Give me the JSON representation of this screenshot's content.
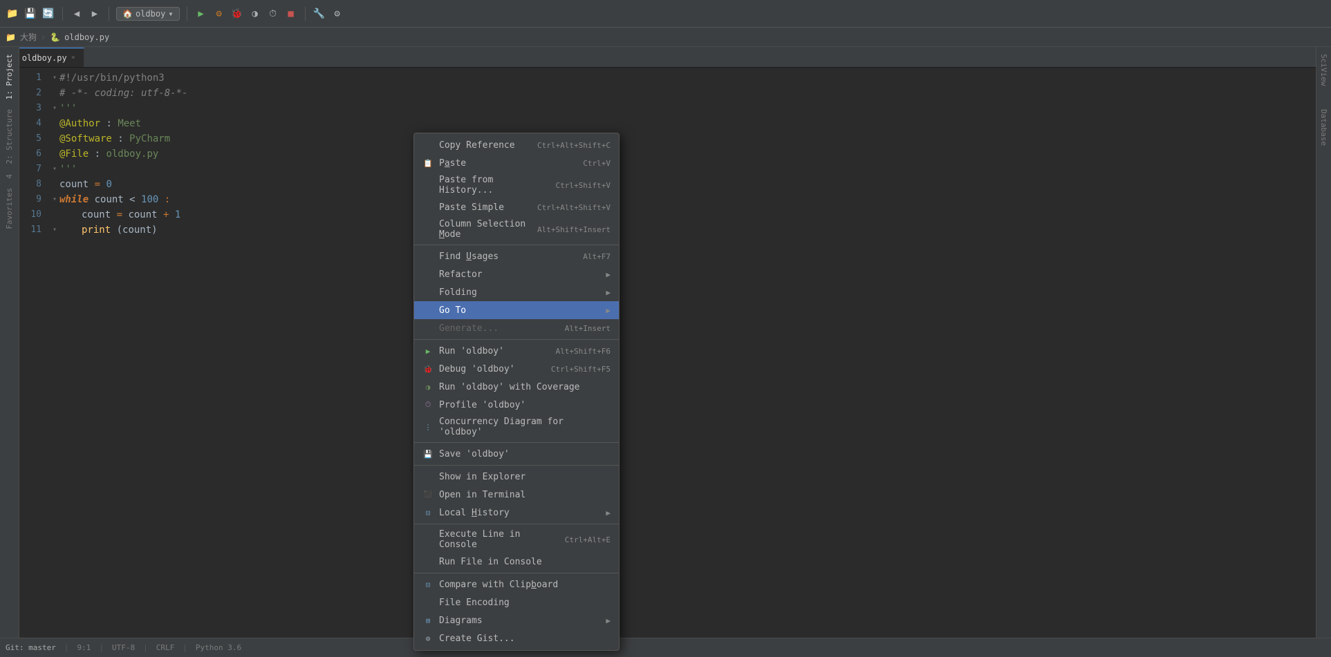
{
  "toolbar": {
    "project_name": "oldboy",
    "dropdown_arrow": "▾"
  },
  "breadcrumb": {
    "items": [
      "大狗",
      "oldboy.py"
    ]
  },
  "tab": {
    "label": "oldboy.py",
    "close": "×"
  },
  "editor": {
    "lines": [
      {
        "num": "1",
        "fold": "▾",
        "html": "shebang"
      },
      {
        "num": "2",
        "fold": "",
        "html": "coding"
      },
      {
        "num": "3",
        "fold": "▾",
        "html": "triple1"
      },
      {
        "num": "4",
        "fold": "",
        "html": "author"
      },
      {
        "num": "5",
        "fold": "",
        "html": "software"
      },
      {
        "num": "6",
        "fold": "",
        "html": "file"
      },
      {
        "num": "7",
        "fold": "▾",
        "html": "triple2"
      },
      {
        "num": "8",
        "fold": "",
        "html": "count_assign"
      },
      {
        "num": "9",
        "fold": "▾",
        "html": "while_line"
      },
      {
        "num": "10",
        "fold": "",
        "html": "count_increment"
      },
      {
        "num": "11",
        "fold": "▾",
        "html": "print_line"
      }
    ]
  },
  "context_menu": {
    "items": [
      {
        "id": "copy-reference",
        "label": "Copy Reference",
        "shortcut": "Ctrl+Alt+Shift+C",
        "icon": "",
        "arrow": false,
        "separator_after": false,
        "disabled": false
      },
      {
        "id": "paste",
        "label": "Paste",
        "shortcut": "Ctrl+V",
        "icon": "📋",
        "arrow": false,
        "separator_after": false,
        "disabled": false
      },
      {
        "id": "paste-history",
        "label": "Paste from History...",
        "shortcut": "Ctrl+Shift+V",
        "icon": "",
        "arrow": false,
        "separator_after": false,
        "disabled": false
      },
      {
        "id": "paste-simple",
        "label": "Paste Simple",
        "shortcut": "Ctrl+Alt+Shift+V",
        "icon": "",
        "arrow": false,
        "separator_after": false,
        "disabled": false
      },
      {
        "id": "column-mode",
        "label": "Column Selection Mode",
        "shortcut": "Alt+Shift+Insert",
        "icon": "",
        "arrow": false,
        "separator_after": true,
        "disabled": false
      },
      {
        "id": "find-usages",
        "label": "Find Usages",
        "shortcut": "Alt+F7",
        "icon": "",
        "arrow": false,
        "separator_after": false,
        "disabled": false
      },
      {
        "id": "refactor",
        "label": "Refactor",
        "shortcut": "",
        "icon": "",
        "arrow": true,
        "separator_after": false,
        "disabled": false
      },
      {
        "id": "folding",
        "label": "Folding",
        "shortcut": "",
        "icon": "",
        "arrow": true,
        "separator_after": false,
        "disabled": false
      },
      {
        "id": "go-to",
        "label": "Go To",
        "shortcut": "",
        "icon": "",
        "arrow": true,
        "separator_after": false,
        "disabled": false,
        "active": true
      },
      {
        "id": "generate",
        "label": "Generate...",
        "shortcut": "Alt+Insert",
        "icon": "",
        "arrow": false,
        "separator_after": true,
        "disabled": true
      },
      {
        "id": "run-oldboy",
        "label": "Run 'oldboy'",
        "shortcut": "Alt+Shift+F6",
        "icon": "▶",
        "arrow": false,
        "separator_after": false,
        "disabled": false
      },
      {
        "id": "debug-oldboy",
        "label": "Debug 'oldboy'",
        "shortcut": "Ctrl+Shift+F5",
        "icon": "🐞",
        "arrow": false,
        "separator_after": false,
        "disabled": false
      },
      {
        "id": "run-coverage",
        "label": "Run 'oldboy' with Coverage",
        "shortcut": "",
        "icon": "◑",
        "arrow": false,
        "separator_after": false,
        "disabled": false
      },
      {
        "id": "profile-oldboy",
        "label": "Profile 'oldboy'",
        "shortcut": "",
        "icon": "⏱",
        "arrow": false,
        "separator_after": false,
        "disabled": false
      },
      {
        "id": "concurrency",
        "label": "Concurrency Diagram for 'oldboy'",
        "shortcut": "",
        "icon": "⋮",
        "arrow": false,
        "separator_after": true,
        "disabled": false
      },
      {
        "id": "save-oldboy",
        "label": "Save 'oldboy'",
        "shortcut": "",
        "icon": "💾",
        "arrow": false,
        "separator_after": true,
        "disabled": false
      },
      {
        "id": "show-explorer",
        "label": "Show in Explorer",
        "shortcut": "",
        "icon": "",
        "arrow": false,
        "separator_after": false,
        "disabled": false
      },
      {
        "id": "open-terminal",
        "label": "Open in Terminal",
        "shortcut": "",
        "icon": "⬛",
        "arrow": false,
        "separator_after": false,
        "disabled": false
      },
      {
        "id": "local-history",
        "label": "Local History",
        "shortcut": "",
        "icon": "",
        "arrow": true,
        "separator_after": true,
        "disabled": false
      },
      {
        "id": "exec-line",
        "label": "Execute Line in Console",
        "shortcut": "Ctrl+Alt+E",
        "icon": "",
        "arrow": false,
        "separator_after": false,
        "disabled": false
      },
      {
        "id": "run-file-console",
        "label": "Run File in Console",
        "shortcut": "",
        "icon": "",
        "arrow": false,
        "separator_after": true,
        "disabled": false
      },
      {
        "id": "compare-clipboard",
        "label": "Compare with Clipboard",
        "shortcut": "",
        "icon": "⊡",
        "arrow": false,
        "separator_after": false,
        "disabled": false
      },
      {
        "id": "file-encoding",
        "label": "File Encoding",
        "shortcut": "",
        "icon": "",
        "arrow": false,
        "separator_after": false,
        "disabled": false
      },
      {
        "id": "diagrams",
        "label": "Diagrams",
        "shortcut": "",
        "icon": "⊞",
        "arrow": true,
        "separator_after": false,
        "disabled": false
      },
      {
        "id": "create-gist",
        "label": "Create Gist...",
        "shortcut": "",
        "icon": "⊙",
        "arrow": false,
        "separator_after": false,
        "disabled": false
      }
    ]
  },
  "sidebar": {
    "left_items": [
      "1: Project",
      "2: Structure",
      "4",
      "Favorites"
    ],
    "right_items": [
      "SciView",
      "Database"
    ]
  },
  "status_bar": {
    "left": "● Python 3.6",
    "git": "Git: master",
    "encoding": "UTF-8",
    "line_col": "9:1",
    "crlf": "CRLF"
  }
}
